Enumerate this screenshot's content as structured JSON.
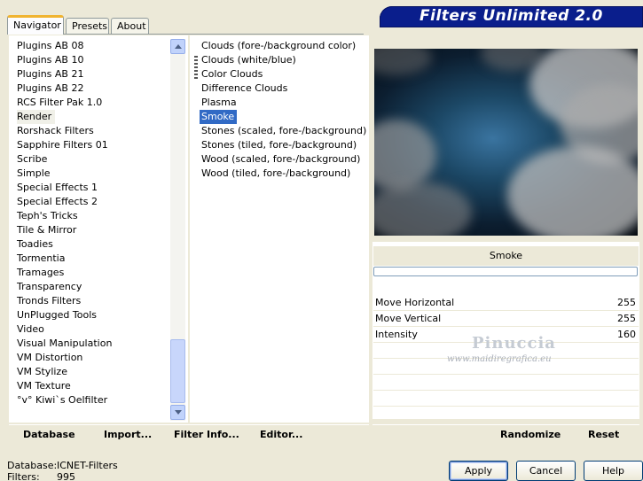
{
  "tabs": [
    {
      "label": "Navigator",
      "active": true
    },
    {
      "label": "Presets",
      "active": false
    },
    {
      "label": "About",
      "active": false
    }
  ],
  "header": {
    "title": "Filters Unlimited 2.0"
  },
  "categories": [
    "Plugins AB 08",
    "Plugins AB 10",
    "Plugins AB 21",
    "Plugins AB 22",
    "RCS Filter Pak 1.0",
    "Render",
    "Rorshack Filters",
    "Sapphire Filters 01",
    "Scribe",
    "Simple",
    "Special Effects 1",
    "Special Effects 2",
    "Teph's Tricks",
    "Tile & Mirror",
    "Toadies",
    "Tormentia",
    "Tramages",
    "Transparency",
    "Tronds Filters",
    "UnPlugged Tools",
    "Video",
    "Visual Manipulation",
    "VM Distortion",
    "VM Stylize",
    "VM Texture",
    "°v° Kiwi`s Oelfilter"
  ],
  "selected_category": "Render",
  "filters": [
    "Clouds (fore-/background color)",
    "Clouds (white/blue)",
    "Color Clouds",
    "Difference Clouds",
    "Plasma",
    "Smoke",
    "Stones (scaled, fore-/background)",
    "Stones (tiled, fore-/background)",
    "Wood (scaled, fore-/background)",
    "Wood (tiled, fore-/background)"
  ],
  "selected_filter": "Smoke",
  "preview": {
    "filter_name": "Smoke"
  },
  "parameters": [
    {
      "name": "Move Horizontal",
      "value": "255"
    },
    {
      "name": "Move Vertical",
      "value": "255"
    },
    {
      "name": "Intensity",
      "value": "160"
    }
  ],
  "watermark": {
    "name": "Pinuccia",
    "url": "www.maidiregrafica.eu"
  },
  "actions_left": [
    {
      "label": "Database",
      "mnemonic": "D"
    },
    {
      "label": "Import...",
      "mnemonic": "I"
    },
    {
      "label": "Filter Info...",
      "mnemonic": "F"
    },
    {
      "label": "Editor...",
      "mnemonic": "E"
    }
  ],
  "actions_right": [
    {
      "label": "Randomize"
    },
    {
      "label": "Reset"
    }
  ],
  "status": {
    "database_label": "Database:",
    "database_value": "ICNET-Filters",
    "filters_label": "Filters:",
    "filters_value": "995"
  },
  "buttons": {
    "apply": "Apply",
    "cancel": "Cancel",
    "help": "Help"
  },
  "colors": {
    "selection": "#316ac5",
    "banner": "#0a1e8c",
    "tab_highlight": "#f0b431"
  }
}
